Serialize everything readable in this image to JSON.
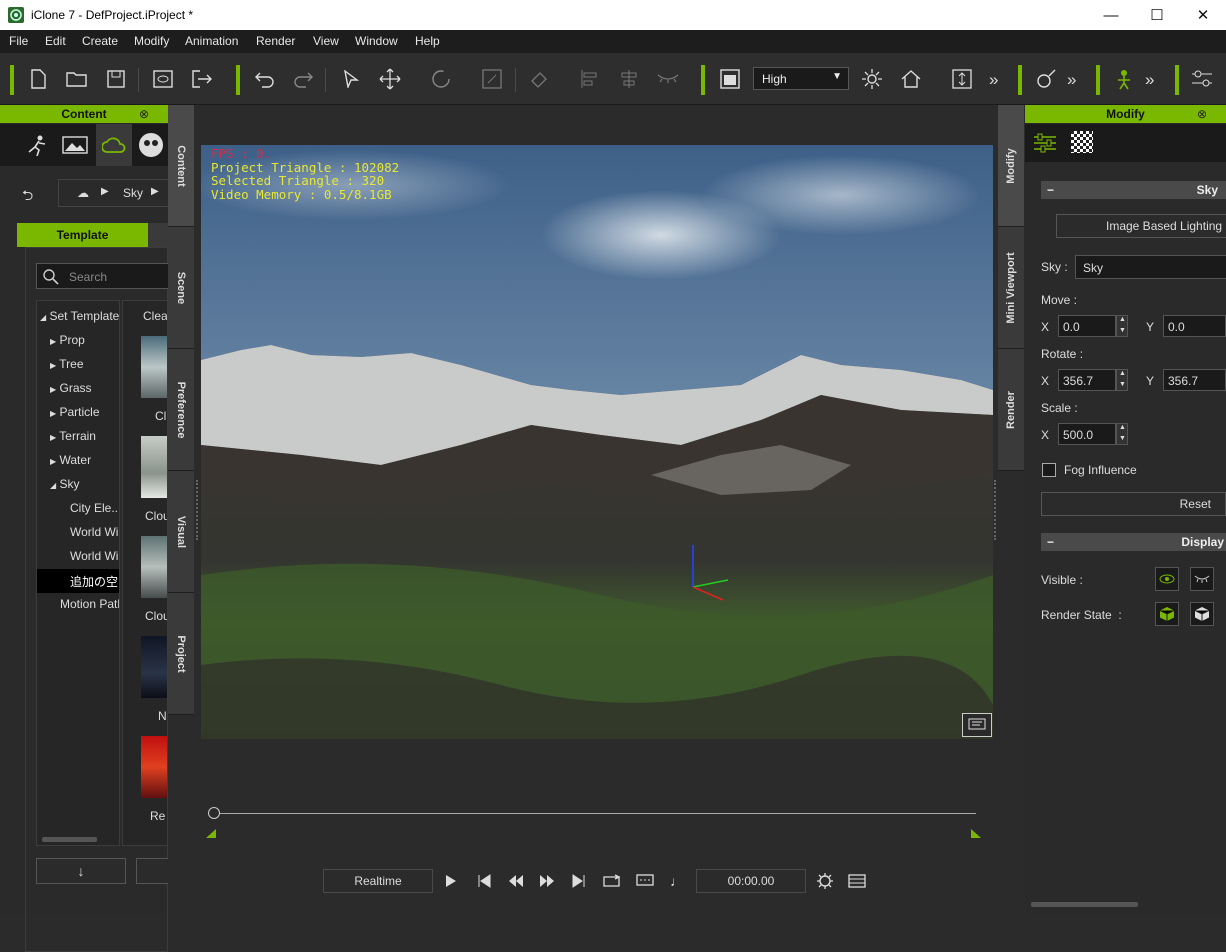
{
  "window": {
    "title": "iClone 7 - DefProject.iProject *",
    "minimize": "—",
    "maximize": "☐",
    "close": "✕"
  },
  "menu": [
    "File",
    "Edit",
    "Create",
    "Modify",
    "Animation",
    "Render",
    "View",
    "Window",
    "Help"
  ],
  "toolbar": {
    "quality": "High",
    "more": "»"
  },
  "content_panel": {
    "title": "Content",
    "breadcrumb": "Sky",
    "tab_template": "Template",
    "search_placeholder": "Search",
    "tree": [
      "Set Template",
      "Prop",
      "Tree",
      "Grass",
      "Particle",
      "Terrain",
      "Water",
      "Sky",
      "City Ele...",
      "World Wi",
      "World Wi",
      "追加の空",
      "Motion Path"
    ],
    "thumbs": [
      {
        "label": "Clea",
        "sub": "Cl"
      },
      {
        "label": "Clou"
      },
      {
        "label": "Clou"
      },
      {
        "label": "N"
      },
      {
        "label": "Re"
      }
    ]
  },
  "side_tabs_left": [
    "Content",
    "Scene",
    "Preference",
    "Visual",
    "Project"
  ],
  "side_tabs_right": [
    "Modify",
    "Mini Viewport",
    "Render"
  ],
  "viewport": {
    "fps": "FPS : 0.",
    "triangles": "Project Triangle : 102082",
    "selected": "Selected Triangle : 320",
    "memory": "Video Memory : 0.5/8.1GB"
  },
  "playback": {
    "mode": "Realtime",
    "time": "00:00.00",
    "progress": 0.0
  },
  "modify_panel": {
    "title": "Modify",
    "section_sky": "Sky",
    "ibl_button": "Image Based Lighting",
    "sky_label": "Sky :",
    "sky_value": "Sky",
    "move_label": "Move :",
    "move_x": "0.0",
    "move_y": "0.0",
    "rotate_label": "Rotate :",
    "rotate_x": "356.7",
    "rotate_y": "356.7",
    "scale_label": "Scale :",
    "scale_x": "500.0",
    "x": "X",
    "y": "Y",
    "fog": "Fog Influence",
    "reset": "Reset",
    "section_display": "Display",
    "visible": "Visible :",
    "render_state": "Render State  :",
    "collapse": "−"
  },
  "colors": {
    "accent": "#7ab800",
    "fps": "#d0304a",
    "hud": "#e8e832"
  }
}
